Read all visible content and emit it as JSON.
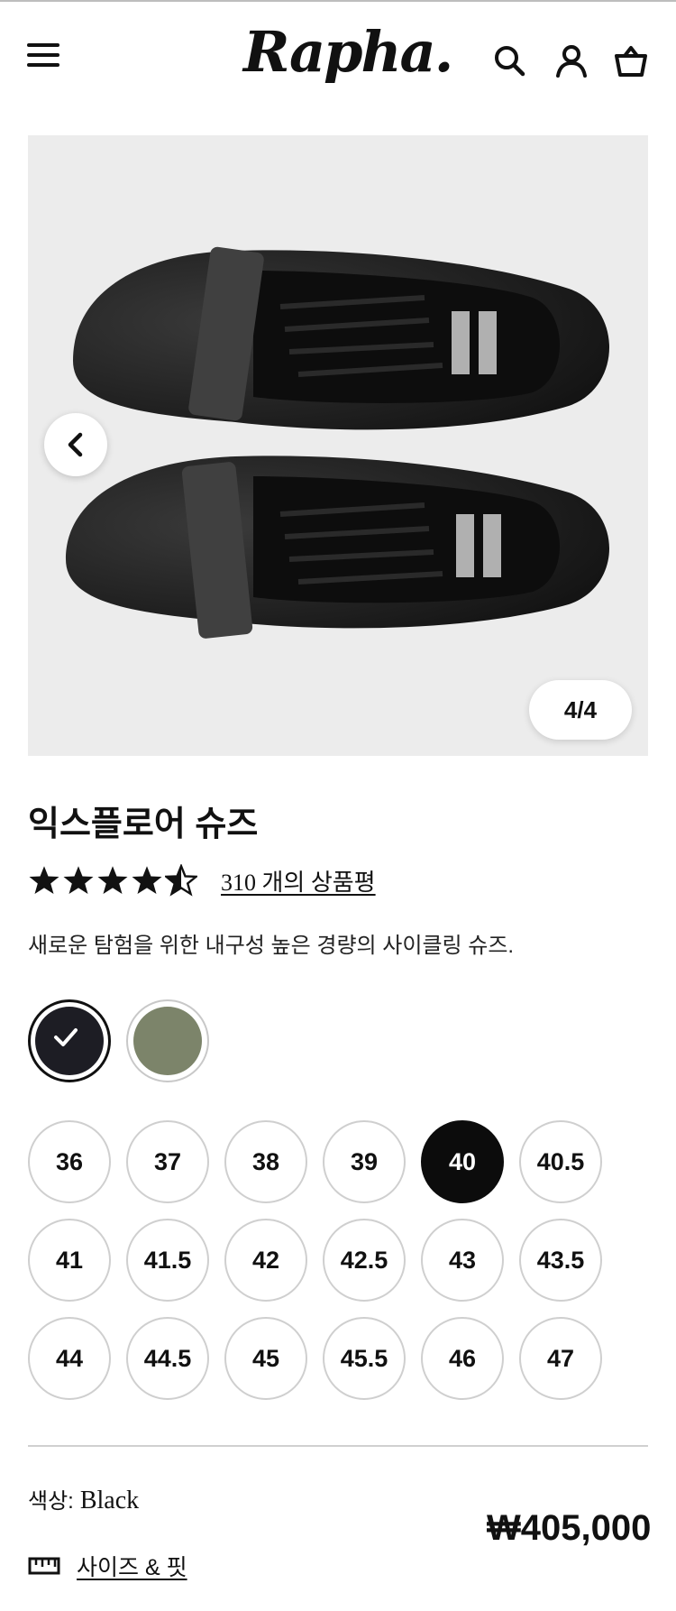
{
  "header": {
    "logo": "Rapha.",
    "menu_icon": "hamburger-menu-icon",
    "search_icon": "search-icon",
    "account_icon": "account-icon",
    "basket_icon": "basket-icon"
  },
  "gallery": {
    "counter": "4/4",
    "prev_icon": "chevron-left-icon"
  },
  "product": {
    "title": "익스플로어 슈즈",
    "rating": 4.5,
    "reviews_label": "310 개의 상품평",
    "description": "새로운 탐험을 위한 내구성 높은 경량의 사이클링 슈즈.",
    "colors": [
      {
        "name": "Black",
        "hex": "#1d1d24",
        "selected": true
      },
      {
        "name": "Olive",
        "hex": "#7c846a",
        "selected": false
      }
    ],
    "sizes": [
      "36",
      "37",
      "38",
      "39",
      "40",
      "40.5",
      "41",
      "41.5",
      "42",
      "42.5",
      "43",
      "43.5",
      "44",
      "44.5",
      "45",
      "45.5",
      "46",
      "47"
    ],
    "selected_size": "40",
    "color_label": "색상:",
    "color_value": "Black",
    "price": "₩405,000",
    "size_fit_label": "사이즈 & 핏"
  }
}
